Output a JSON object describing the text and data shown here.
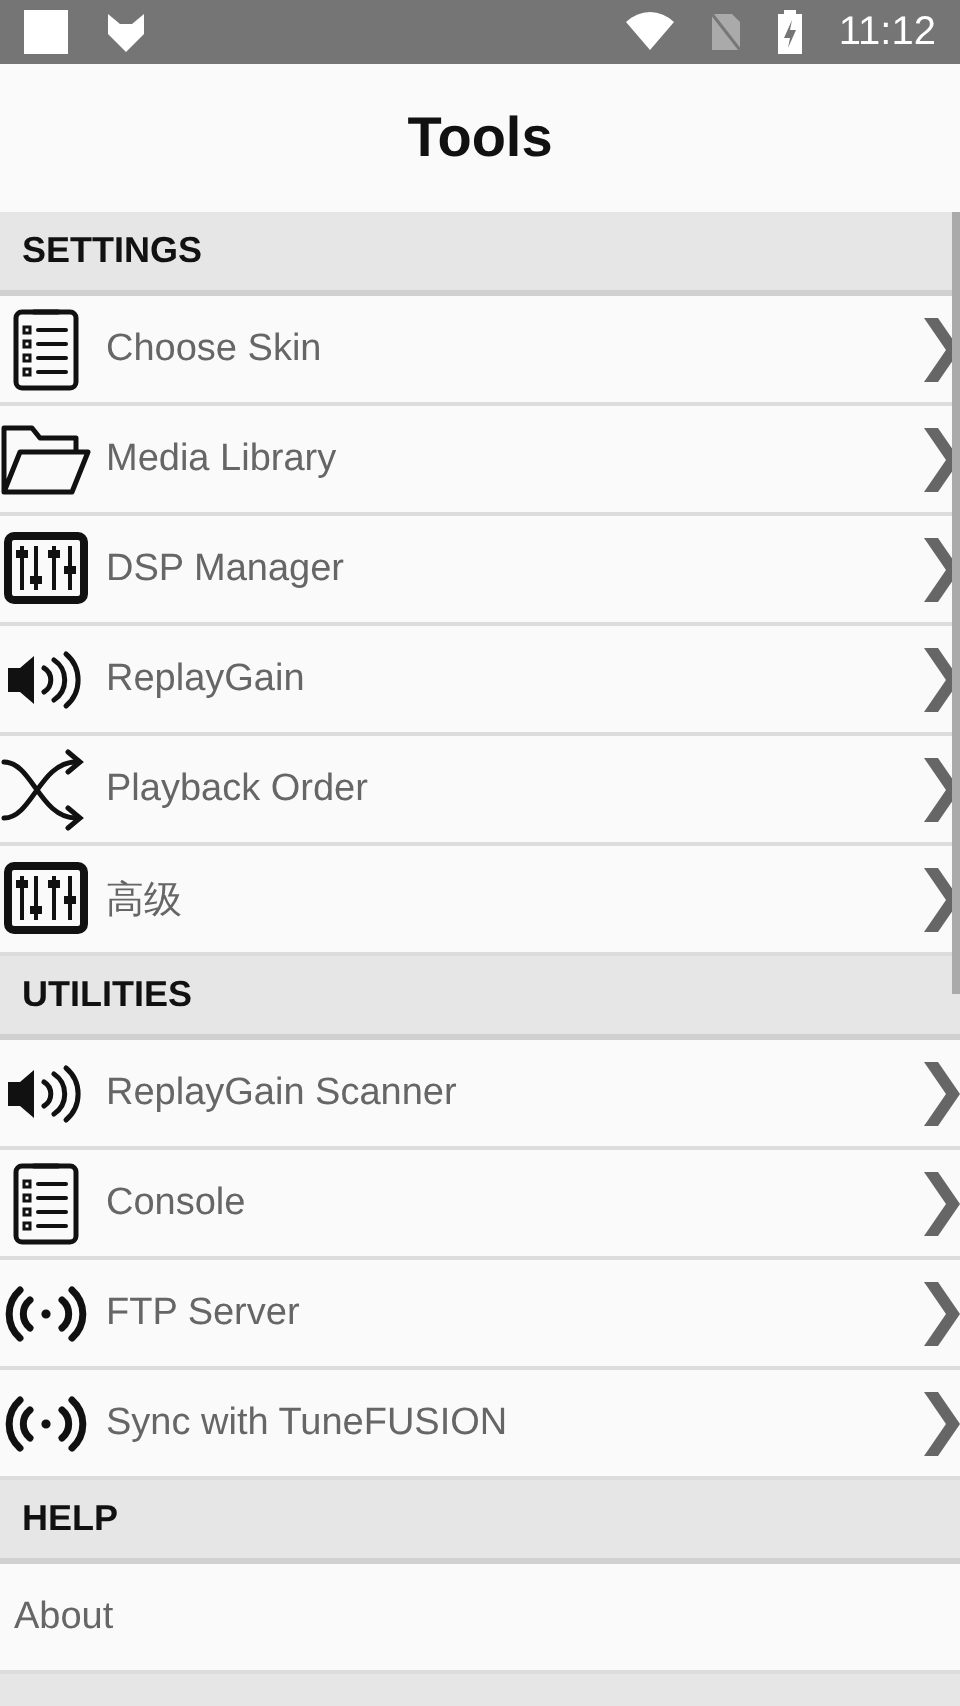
{
  "status_bar": {
    "time": "11:12"
  },
  "title": "Tools",
  "sections": [
    {
      "header": "SETTINGS",
      "items": [
        {
          "label": "Choose Skin",
          "kind": "clipboard"
        },
        {
          "label": "Media Library",
          "kind": "folder"
        },
        {
          "label": "DSP Manager",
          "kind": "sliders"
        },
        {
          "label": "ReplayGain",
          "kind": "speaker"
        },
        {
          "label": "Playback Order",
          "kind": "shuffle"
        },
        {
          "label": "高级",
          "kind": "sliders"
        }
      ]
    },
    {
      "header": "UTILITIES",
      "items": [
        {
          "label": "ReplayGain Scanner",
          "kind": "speaker"
        },
        {
          "label": "Console",
          "kind": "clipboard"
        },
        {
          "label": "FTP Server",
          "kind": "broadcast"
        },
        {
          "label": "Sync with TuneFUSION",
          "kind": "broadcast"
        }
      ]
    },
    {
      "header": "HELP",
      "items": [
        {
          "label": "About",
          "kind": "plain"
        }
      ]
    }
  ]
}
